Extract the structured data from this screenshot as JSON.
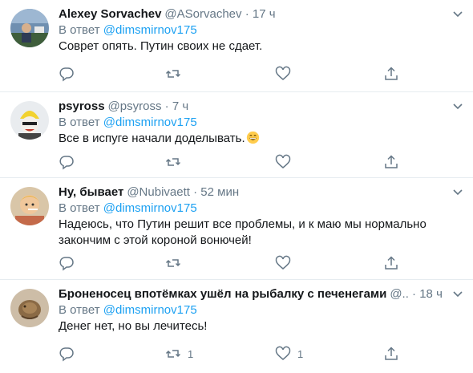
{
  "colors": {
    "link": "#1da1f2",
    "secondary_text": "#657786",
    "divider": "#e6ecf0"
  },
  "tweets": [
    {
      "name": "Alexey Sorvachev",
      "handle": "@ASorvachev",
      "separator": "·",
      "time": "17 ч",
      "reply_prefix": "В ответ",
      "mention": "@dimsmirnov175",
      "text": "Соврет опять. Путин своих не сдает.",
      "reply_count": "",
      "retweet_count": "",
      "like_count": ""
    },
    {
      "name": "psyross",
      "handle": "@psyross",
      "separator": "·",
      "time": "7 ч",
      "reply_prefix": "В ответ",
      "mention": "@dimsmirnov175",
      "text": "Все в испуге начали доделывать.",
      "text_emoji": "grinning-face-emoji",
      "reply_count": "",
      "retweet_count": "",
      "like_count": ""
    },
    {
      "name": "Ну, бывает",
      "handle": "@Nubivaett",
      "separator": "·",
      "time": "52 мин",
      "reply_prefix": "В ответ",
      "mention": "@dimsmirnov175",
      "text": "Надеюсь, что Путин решит все проблемы, и к маю мы нормально закончим с этой короной вонючей!",
      "reply_count": "",
      "retweet_count": "",
      "like_count": ""
    },
    {
      "name": "Броненосец впотёмках ушёл на рыбалку с печенегами",
      "handle": "@..",
      "separator": "·",
      "time": "18 ч",
      "reply_prefix": "В ответ",
      "mention": "@dimsmirnov175",
      "text": "Денег нет, но вы лечитесь!",
      "reply_count": "",
      "retweet_count": "1",
      "like_count": "1"
    }
  ],
  "icons": {
    "reply": "reply-icon",
    "retweet": "retweet-icon",
    "like": "heart-icon",
    "share": "share-icon",
    "more": "chevron-down-icon"
  }
}
